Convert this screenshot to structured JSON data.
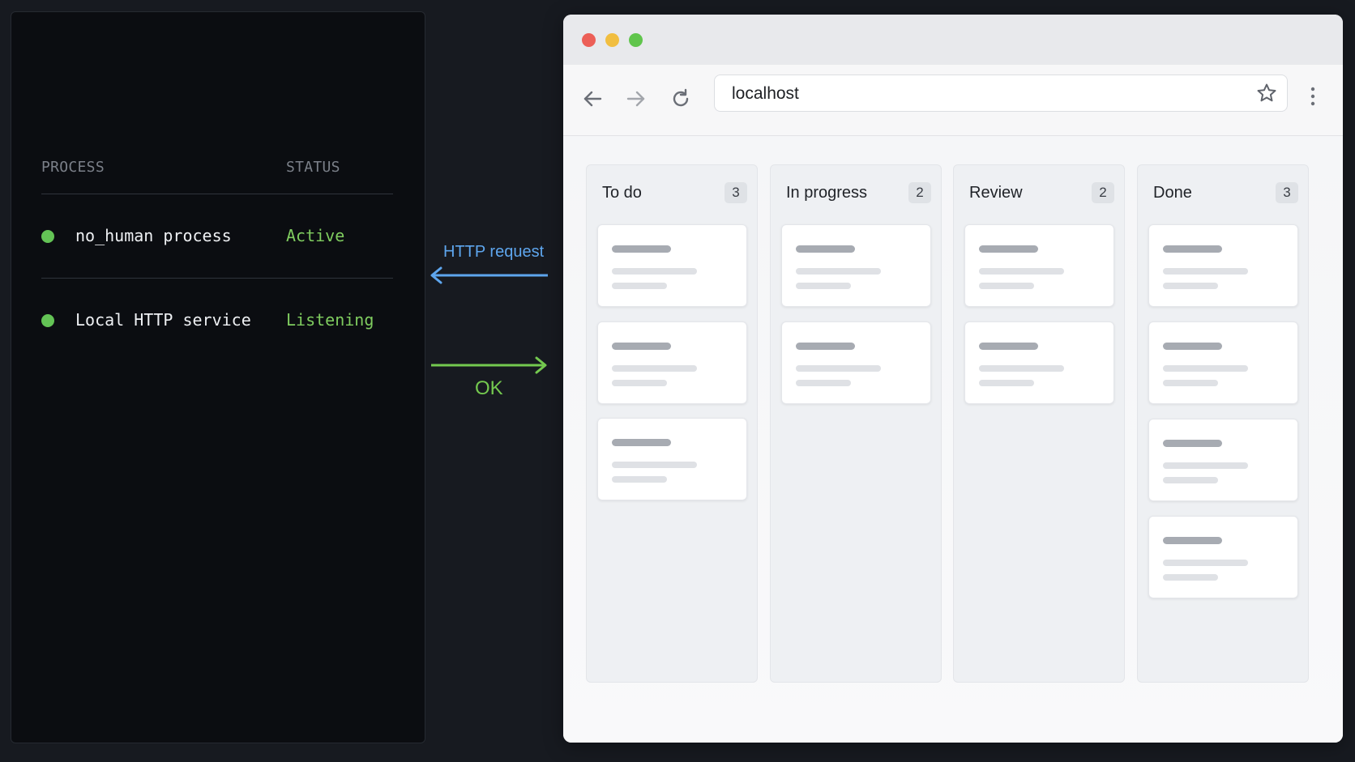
{
  "terminal": {
    "header": {
      "process": "PROCESS",
      "status": "STATUS"
    },
    "rows": [
      {
        "name": "no_human process",
        "status": "Active"
      },
      {
        "name": "Local HTTP service",
        "status": "Listening"
      }
    ],
    "colors": {
      "dot": "#63c355",
      "status": "#7fcc5f"
    }
  },
  "flow": {
    "request_label": "HTTP request",
    "response_label": "OK",
    "colors": {
      "request": "#5ea6ee",
      "response": "#74c94f"
    }
  },
  "browser": {
    "url": "localhost",
    "icons": [
      "back-arrow-icon",
      "forward-arrow-icon",
      "reload-icon",
      "star-icon",
      "more-vert-icon"
    ],
    "columns": [
      {
        "title": "To do",
        "count": "3",
        "cards": 3
      },
      {
        "title": "In progress",
        "count": "2",
        "cards": 2
      },
      {
        "title": "Review",
        "count": "2",
        "cards": 2
      },
      {
        "title": "Done",
        "count": "3",
        "cards": 4
      }
    ]
  }
}
